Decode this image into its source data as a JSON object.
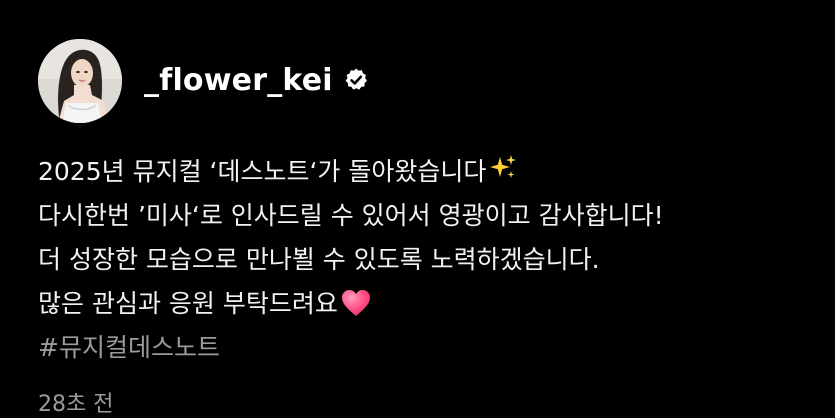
{
  "post": {
    "username": "_flower_kei",
    "verified": true,
    "lines": [
      "2025년 뮤지컬 ‘데스노트‘가 돌아왔습니다",
      "다시한번 ’미사‘로 인사드릴 수 있어서 영광이고 감사합니다!",
      "더 성장한 모습으로 만나뵐 수 있도록 노력하겠습니다.",
      "많은 관심과 응원 부탁드려요"
    ],
    "hashtag": "#뮤지컬데스노트",
    "timestamp": "28초 전"
  },
  "icons": {
    "verified": "verified-badge-icon",
    "sparkles": "sparkles-emoji",
    "heart": "pink-heart-emoji"
  },
  "colors": {
    "background": "#000000",
    "text": "#f2f2f2",
    "muted": "#9b9b9b",
    "heart": "#ff4f86",
    "sparkles": "#ffcc33"
  }
}
